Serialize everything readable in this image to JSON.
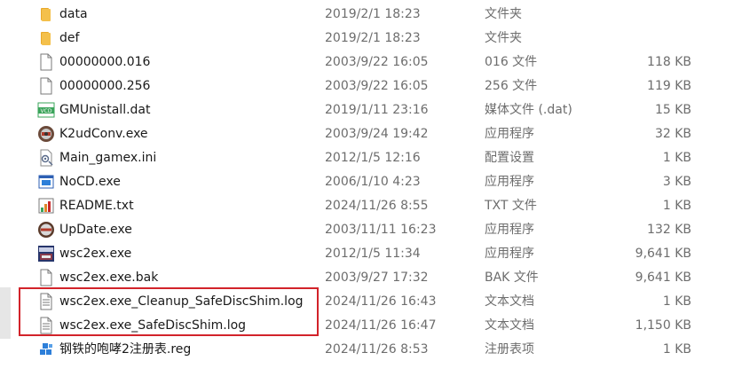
{
  "files": [
    {
      "name": "data",
      "date": "2019/2/1 18:23",
      "type": "文件夹",
      "size": "",
      "icon": "folder-icon"
    },
    {
      "name": "def",
      "date": "2019/2/1 18:23",
      "type": "文件夹",
      "size": "",
      "icon": "folder-icon"
    },
    {
      "name": "00000000.016",
      "date": "2003/9/22 16:05",
      "type": "016 文件",
      "size": "118 KB",
      "icon": "blank-file-icon"
    },
    {
      "name": "00000000.256",
      "date": "2003/9/22 16:05",
      "type": "256 文件",
      "size": "119 KB",
      "icon": "blank-file-icon"
    },
    {
      "name": "GMUnistall.dat",
      "date": "2019/1/11 23:16",
      "type": "媒体文件 (.dat)",
      "size": "15 KB",
      "icon": "vcd-media-icon"
    },
    {
      "name": "K2udConv.exe",
      "date": "2003/9/24 19:42",
      "type": "应用程序",
      "size": "32 KB",
      "icon": "k2udconv-app-icon"
    },
    {
      "name": "Main_gamex.ini",
      "date": "2012/1/5 12:16",
      "type": "配置设置",
      "size": "1 KB",
      "icon": "settings-file-icon"
    },
    {
      "name": "NoCD.exe",
      "date": "2006/1/10 4:23",
      "type": "应用程序",
      "size": "3 KB",
      "icon": "window-app-icon"
    },
    {
      "name": "README.txt",
      "date": "2024/11/26 8:55",
      "type": "TXT 文件",
      "size": "1 KB",
      "icon": "text-chart-icon"
    },
    {
      "name": "UpDate.exe",
      "date": "2003/11/11 16:23",
      "type": "应用程序",
      "size": "132 KB",
      "icon": "update-app-icon"
    },
    {
      "name": "wsc2ex.exe",
      "date": "2012/1/5 11:34",
      "type": "应用程序",
      "size": "9,641 KB",
      "icon": "game-app-icon"
    },
    {
      "name": "wsc2ex.exe.bak",
      "date": "2003/9/27 17:32",
      "type": "BAK 文件",
      "size": "9,641 KB",
      "icon": "blank-file-icon"
    },
    {
      "name": "wsc2ex.exe_Cleanup_SafeDiscShim.log",
      "date": "2024/11/26 16:43",
      "type": "文本文档",
      "size": "1 KB",
      "icon": "text-document-icon"
    },
    {
      "name": "wsc2ex.exe_SafeDiscShim.log",
      "date": "2024/11/26 16:47",
      "type": "文本文档",
      "size": "1,150 KB",
      "icon": "text-document-icon"
    },
    {
      "name": "钢铁的咆哮2注册表.reg",
      "date": "2024/11/26 8:53",
      "type": "注册表项",
      "size": "1 KB",
      "icon": "registry-icon"
    }
  ],
  "colors": {
    "text": "#1a1a1a",
    "meta_text": "#6d6d6d",
    "folder": "#f4c04b",
    "highlight_border": "#d2232a"
  }
}
